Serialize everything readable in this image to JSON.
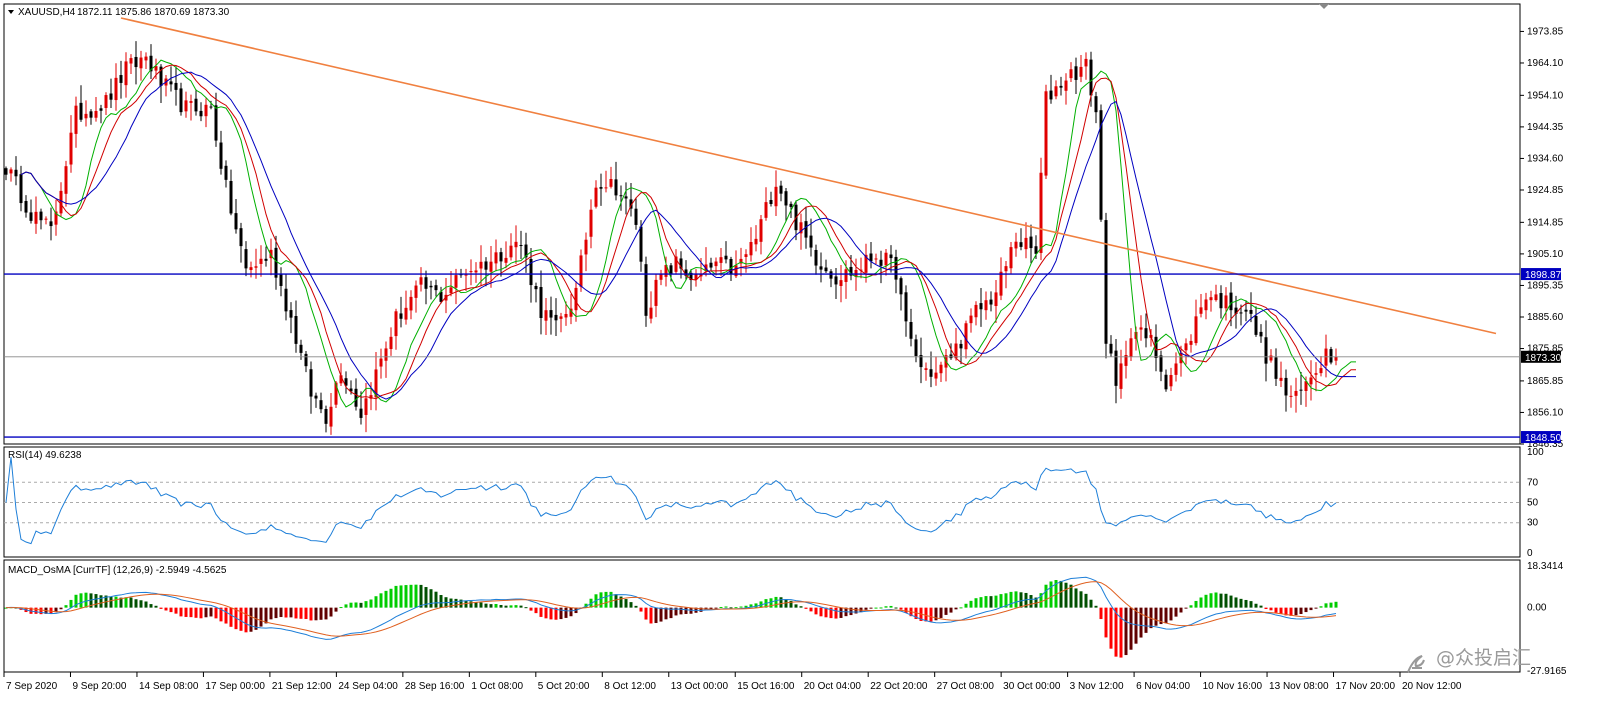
{
  "header": {
    "symbol": "XAUUSD,H4",
    "ohlc": "1872.11 1875.86 1870.69 1873.30"
  },
  "colors": {
    "bull": "#e00000",
    "bear": "#000000",
    "ma_fast": "#00b000",
    "ma_mid": "#d00000",
    "ma_slow": "#0000c0",
    "trendline": "#f08040",
    "hline": "#0000c0",
    "rsi": "#1e7fd8",
    "macd_up_strong": "#00cc00",
    "macd_up_weak": "#005000",
    "macd_down_strong": "#ff0000",
    "macd_down_weak": "#600000",
    "macd_line": "#1e7fd8",
    "signal_line": "#e06020"
  },
  "price_axis": {
    "min": 1846.35,
    "max": 1978.0,
    "ticks": [
      "1973.85",
      "1964.10",
      "1954.10",
      "1944.35",
      "1934.60",
      "1924.85",
      "1914.85",
      "1905.10",
      "1895.35",
      "1885.60",
      "1875.85",
      "1865.85",
      "1856.10",
      "1846.35"
    ],
    "tags": [
      {
        "label": "1898.87",
        "value": 1898.87,
        "color": "#0000c0"
      },
      {
        "label": "1873.30",
        "value": 1873.3,
        "color": "#000000"
      },
      {
        "label": "1848.50",
        "value": 1848.5,
        "color": "#0000c0"
      }
    ]
  },
  "time_axis": {
    "labels": [
      "7 Sep 2020",
      "9 Sep 20:00",
      "14 Sep 08:00",
      "17 Sep 00:00",
      "21 Sep 12:00",
      "24 Sep 04:00",
      "28 Sep 16:00",
      "1 Oct 08:00",
      "5 Oct 20:00",
      "8 Oct 12:00",
      "13 Oct 00:00",
      "15 Oct 16:00",
      "20 Oct 04:00",
      "22 Oct 20:00",
      "27 Oct 08:00",
      "30 Oct 00:00",
      "3 Nov 12:00",
      "6 Nov 04:00",
      "10 Nov 16:00",
      "13 Nov 08:00",
      "17 Nov 20:00",
      "20 Nov 12:00"
    ]
  },
  "rsi": {
    "title": "RSI(14) 49.6238",
    "ticks": [
      "100",
      "70",
      "50",
      "30",
      "0"
    ],
    "levels": [
      70,
      50,
      30
    ]
  },
  "macd": {
    "title": "MACD_OsMA [CurrTF] (12,26,9) -2.5949 -4.5625",
    "ticks": [
      "18.3414",
      "0.00",
      "-27.9165"
    ],
    "max": 18.3414,
    "min": -27.9165
  },
  "watermark": "@众投启汇",
  "chart_data": {
    "type": "candlestick",
    "title": "XAUUSD,H4",
    "xlabel": "",
    "ylabel": "",
    "ylim": [
      1846.35,
      1978.0
    ],
    "anchors": [
      {
        "bar": 0,
        "price": 1932
      },
      {
        "bar": 5,
        "price": 1918
      },
      {
        "bar": 9,
        "price": 1912
      },
      {
        "bar": 14,
        "price": 1948
      },
      {
        "bar": 20,
        "price": 1952
      },
      {
        "bar": 24,
        "price": 1962
      },
      {
        "bar": 28,
        "price": 1966
      },
      {
        "bar": 31,
        "price": 1958
      },
      {
        "bar": 36,
        "price": 1950
      },
      {
        "bar": 41,
        "price": 1950
      },
      {
        "bar": 44,
        "price": 1925
      },
      {
        "bar": 48,
        "price": 1900
      },
      {
        "bar": 53,
        "price": 1905
      },
      {
        "bar": 57,
        "price": 1885
      },
      {
        "bar": 61,
        "price": 1862
      },
      {
        "bar": 64,
        "price": 1855
      },
      {
        "bar": 67,
        "price": 1870
      },
      {
        "bar": 71,
        "price": 1856
      },
      {
        "bar": 74,
        "price": 1868
      },
      {
        "bar": 78,
        "price": 1885
      },
      {
        "bar": 83,
        "price": 1895
      },
      {
        "bar": 87,
        "price": 1892
      },
      {
        "bar": 92,
        "price": 1900
      },
      {
        "bar": 97,
        "price": 1903
      },
      {
        "bar": 101,
        "price": 1908
      },
      {
        "bar": 103,
        "price": 1908
      },
      {
        "bar": 107,
        "price": 1888
      },
      {
        "bar": 110,
        "price": 1882
      },
      {
        "bar": 114,
        "price": 1893
      },
      {
        "bar": 118,
        "price": 1928
      },
      {
        "bar": 122,
        "price": 1926
      },
      {
        "bar": 126,
        "price": 1915
      },
      {
        "bar": 128,
        "price": 1888
      },
      {
        "bar": 131,
        "price": 1898
      },
      {
        "bar": 134,
        "price": 1902
      },
      {
        "bar": 138,
        "price": 1897
      },
      {
        "bar": 142,
        "price": 1902
      },
      {
        "bar": 146,
        "price": 1900
      },
      {
        "bar": 150,
        "price": 1910
      },
      {
        "bar": 154,
        "price": 1928
      },
      {
        "bar": 158,
        "price": 1915
      },
      {
        "bar": 162,
        "price": 1904
      },
      {
        "bar": 166,
        "price": 1898
      },
      {
        "bar": 170,
        "price": 1900
      },
      {
        "bar": 174,
        "price": 1905
      },
      {
        "bar": 178,
        "price": 1900
      },
      {
        "bar": 180,
        "price": 1882
      },
      {
        "bar": 183,
        "price": 1870
      },
      {
        "bar": 186,
        "price": 1868
      },
      {
        "bar": 190,
        "price": 1876
      },
      {
        "bar": 194,
        "price": 1887
      },
      {
        "bar": 198,
        "price": 1893
      },
      {
        "bar": 202,
        "price": 1910
      },
      {
        "bar": 206,
        "price": 1905
      },
      {
        "bar": 208,
        "price": 1953
      },
      {
        "bar": 212,
        "price": 1960
      },
      {
        "bar": 216,
        "price": 1963
      },
      {
        "bar": 218,
        "price": 1949
      },
      {
        "bar": 220,
        "price": 1880
      },
      {
        "bar": 222,
        "price": 1863
      },
      {
        "bar": 225,
        "price": 1882
      },
      {
        "bar": 229,
        "price": 1878
      },
      {
        "bar": 232,
        "price": 1866
      },
      {
        "bar": 236,
        "price": 1876
      },
      {
        "bar": 240,
        "price": 1893
      },
      {
        "bar": 244,
        "price": 1890
      },
      {
        "bar": 248,
        "price": 1888
      },
      {
        "bar": 252,
        "price": 1874
      },
      {
        "bar": 256,
        "price": 1862
      },
      {
        "bar": 258,
        "price": 1860
      },
      {
        "bar": 262,
        "price": 1870
      },
      {
        "bar": 264,
        "price": 1875
      },
      {
        "bar": 266,
        "price": 1873.3
      }
    ],
    "bar_count": 267,
    "trendline": {
      "from_bar": 23,
      "from_price": 1978.0,
      "to_bar": 298,
      "to_price": 1880.5
    },
    "horizontal_lines": [
      1898.87,
      1848.5,
      1873.3
    ]
  }
}
